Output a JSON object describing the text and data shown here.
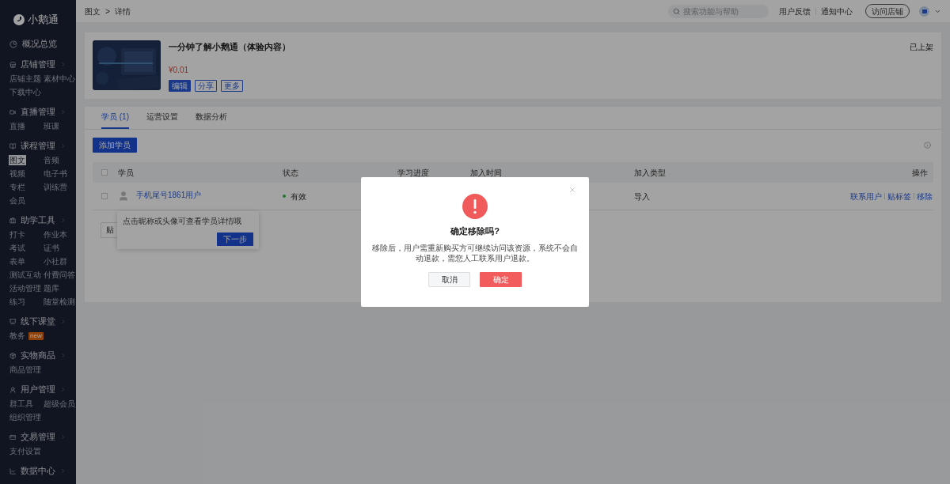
{
  "sidebar": {
    "logo": "小鹅通",
    "sections": [
      {
        "title": "概况总览",
        "chevron": false
      },
      {
        "title": "店铺管理",
        "chevron": true,
        "items": [
          {
            "label": "店铺主题",
            "selected": false
          },
          {
            "label": "素材中心",
            "selected": false
          },
          {
            "label": "下载中心",
            "selected": false
          }
        ]
      },
      {
        "title": "直播管理",
        "chevron": true,
        "items": [
          {
            "label": "直播",
            "selected": false
          },
          {
            "label": "班课",
            "selected": false
          }
        ]
      },
      {
        "title": "课程管理",
        "chevron": true,
        "items": [
          {
            "label": "图文",
            "selected": true
          },
          {
            "label": "音频",
            "selected": false
          },
          {
            "label": "视频",
            "selected": false
          },
          {
            "label": "电子书",
            "selected": false
          },
          {
            "label": "专栏",
            "selected": false
          },
          {
            "label": "训练营",
            "selected": false
          },
          {
            "label": "会员",
            "selected": false
          }
        ]
      },
      {
        "title": "助学工具",
        "chevron": true,
        "items": [
          {
            "label": "打卡",
            "selected": false
          },
          {
            "label": "作业本",
            "selected": false
          },
          {
            "label": "考试",
            "selected": false
          },
          {
            "label": "证书",
            "selected": false
          },
          {
            "label": "表单",
            "selected": false
          },
          {
            "label": "小社群",
            "selected": false
          },
          {
            "label": "测试互动",
            "selected": false
          },
          {
            "label": "付费问答",
            "selected": false
          },
          {
            "label": "活动管理",
            "selected": false
          },
          {
            "label": "题库",
            "selected": false
          },
          {
            "label": "练习",
            "selected": false
          },
          {
            "label": "随堂检测",
            "selected": false
          }
        ]
      },
      {
        "title": "线下课堂",
        "chevron": true,
        "items": [
          {
            "label": "教务",
            "selected": false,
            "badge": "new"
          }
        ]
      },
      {
        "title": "实物商品",
        "chevron": true,
        "items": [
          {
            "label": "商品管理",
            "selected": false
          }
        ]
      },
      {
        "title": "用户管理",
        "chevron": true,
        "items": [
          {
            "label": "群工具",
            "selected": false
          },
          {
            "label": "超级会员",
            "selected": false
          },
          {
            "label": "组织管理",
            "selected": false
          }
        ]
      },
      {
        "title": "交易管理",
        "chevron": true,
        "items": [
          {
            "label": "支付设置",
            "selected": false
          }
        ]
      },
      {
        "title": "数据中心",
        "chevron": true
      }
    ]
  },
  "topbar": {
    "breadcrumb": [
      "图文",
      "详情"
    ],
    "breadcrumb_separator": ">",
    "search": {
      "placeholder": "搜索功能与帮助"
    },
    "links": [
      "用户反馈",
      "通知中心"
    ],
    "visit_button": "访问店铺"
  },
  "product": {
    "title": "一分钟了解小鹅通（体验内容）",
    "price": "¥0.01",
    "status": "已上架",
    "buttons": [
      {
        "label": "编辑",
        "primary": true
      },
      {
        "label": "分享",
        "primary": false
      },
      {
        "label": "更多",
        "primary": false
      }
    ]
  },
  "tabs": [
    {
      "label": "学员 (1)",
      "selected": true
    },
    {
      "label": "运营设置",
      "selected": false
    },
    {
      "label": "数据分析",
      "selected": false
    }
  ],
  "add_button": "添加学员",
  "table": {
    "all_checked": false,
    "columns": [
      "学员",
      "状态",
      "学习进度",
      "加入时间",
      "加入类型",
      "操作"
    ],
    "rows": [
      {
        "checked": false,
        "name": "手机尾号1861用户",
        "status": "有效",
        "color": "#26732f",
        "join_type": "导入",
        "actions": [
          "联系用户",
          "贴标签",
          "移除"
        ]
      }
    ]
  },
  "bulk_button": "贴",
  "guide": {
    "text": "点击昵称或头像可查看学员详情哦",
    "button": "下一步"
  },
  "dialog": {
    "title": "确定移除吗?",
    "message": "移除后，用户需重新购买方可继续访问该资源，系统不会自动退款，需您人工联系用户退款。",
    "buttons": [
      {
        "label": "取消",
        "primary": false
      },
      {
        "label": "确定",
        "primary": true
      }
    ]
  }
}
